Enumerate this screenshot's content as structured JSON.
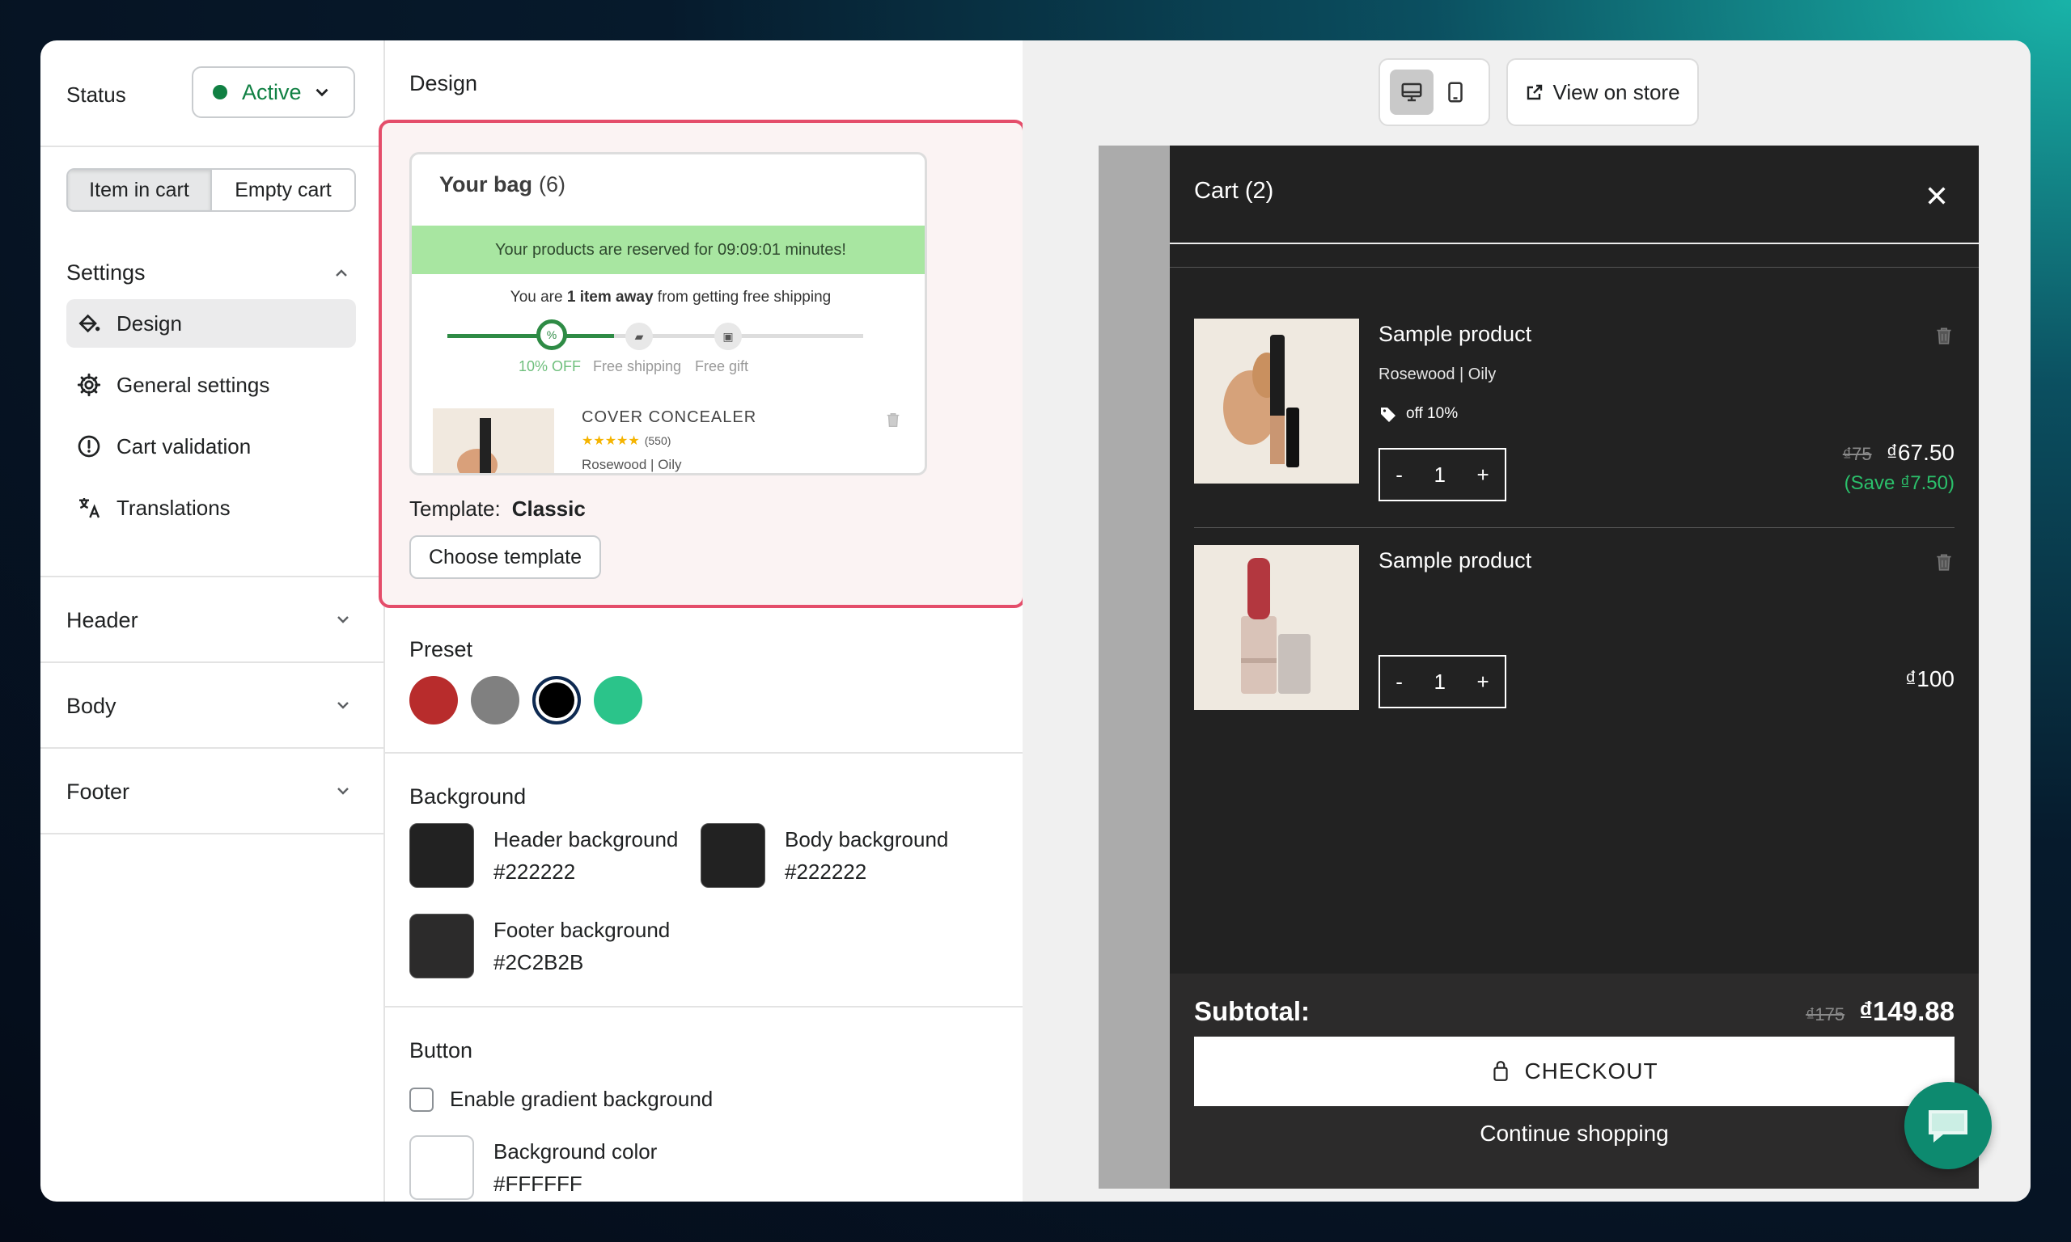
{
  "status": {
    "label": "Status",
    "value": "Active",
    "color": "#108043"
  },
  "cart_state_tabs": [
    {
      "label": "Item in cart",
      "active": true
    },
    {
      "label": "Empty cart",
      "active": false
    }
  ],
  "settings": {
    "title": "Settings",
    "items": [
      {
        "label": "Design",
        "icon": "paint-bucket-icon",
        "active": true
      },
      {
        "label": "General settings",
        "icon": "gear-icon"
      },
      {
        "label": "Cart validation",
        "icon": "alert-circle-icon"
      },
      {
        "label": "Translations",
        "icon": "translate-icon"
      }
    ]
  },
  "sections": [
    {
      "label": "Header"
    },
    {
      "label": "Body"
    },
    {
      "label": "Footer"
    }
  ],
  "design": {
    "title": "Design",
    "template_preview": {
      "title": "Your bag",
      "count": "(6)",
      "banner": "Your products are reserved for 09:09:01 minutes!",
      "away_prefix": "You are ",
      "away_bold": "1 item away",
      "away_suffix": " from getting free shipping",
      "progress": 0.4,
      "milestones": [
        "10% OFF",
        "Free shipping",
        "Free gift"
      ],
      "product_name": "COVER CONCEALER",
      "stars": "★★★★★",
      "reviews": "(550)",
      "variant": "Rosewood | Oily"
    },
    "template_label": "Template:",
    "template_value": "Classic",
    "choose_button": "Choose template",
    "preset_title": "Preset",
    "presets": [
      {
        "color": "#b82c2c",
        "selected": false
      },
      {
        "color": "#808080",
        "selected": false
      },
      {
        "color": "#000000",
        "selected": true
      },
      {
        "color": "#2bc48a",
        "selected": false
      }
    ],
    "background_title": "Background",
    "backgrounds": [
      {
        "label": "Header background",
        "value": "#222222"
      },
      {
        "label": "Body background",
        "value": "#222222"
      },
      {
        "label": "Footer background",
        "value": "#2C2B2B"
      }
    ],
    "button_title": "Button",
    "gradient_label": "Enable gradient background",
    "button_bg": {
      "label": "Background color",
      "value": "#FFFFFF"
    }
  },
  "preview": {
    "view_store": "View on store",
    "cart_title": "Cart (2)",
    "items": [
      {
        "name": "Sample product",
        "variant": "Rosewood | Oily",
        "discount": "off 10%",
        "qty": "1",
        "compare_price": "₫75",
        "price": "₫67.50",
        "save": "(Save ₫7.50)"
      },
      {
        "name": "Sample product",
        "qty": "1",
        "price": "₫100"
      }
    ],
    "subtotal_label": "Subtotal:",
    "subtotal_compare": "₫175",
    "subtotal_value": "₫149.88",
    "checkout": "CHECKOUT",
    "continue": "Continue shopping",
    "qty_minus": "-",
    "qty_plus": "+"
  }
}
